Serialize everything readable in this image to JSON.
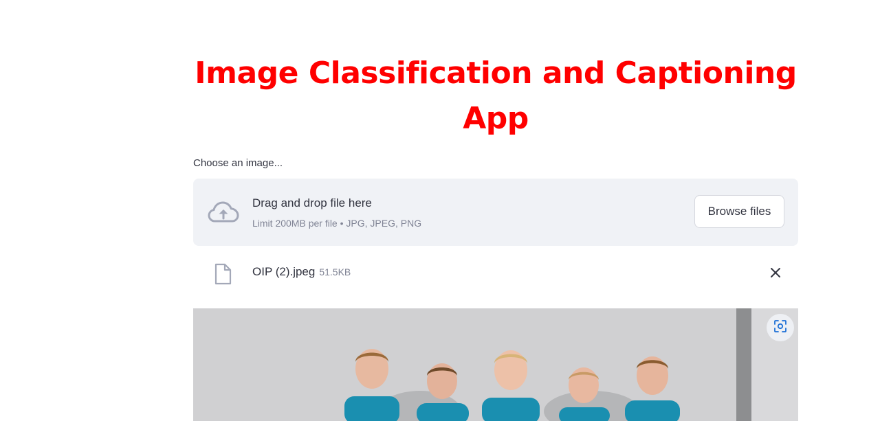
{
  "app": {
    "title": "Image Classification and Captioning App"
  },
  "uploader": {
    "label": "Choose an image...",
    "drag_text": "Drag and drop file here",
    "limit_text": "Limit 200MB per file • JPG, JPEG, PNG",
    "browse_label": "Browse files",
    "icon": "cloud-upload-icon"
  },
  "uploaded_file": {
    "name": "OIP (2).jpeg",
    "size": "51.5KB",
    "icon": "file-icon",
    "remove_icon": "close-icon"
  },
  "image": {
    "fullscreen_icon": "fullscreen-icon"
  },
  "colors": {
    "title": "#ff0000",
    "dropzone_bg": "#f0f2f6",
    "text": "#31333f",
    "muted": "#808495",
    "icon": "#a3a8b8"
  }
}
